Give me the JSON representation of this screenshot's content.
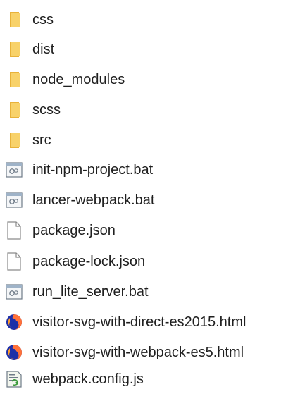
{
  "colors": {
    "folder": "#f5c542",
    "folder_dark": "#d9a520",
    "text": "#1f1f1f",
    "firefox_orange": "#ff7139",
    "firefox_blue": "#1d2fa8"
  },
  "items": [
    {
      "name": "css",
      "icon": "folder-icon"
    },
    {
      "name": "dist",
      "icon": "folder-icon"
    },
    {
      "name": "node_modules",
      "icon": "folder-icon"
    },
    {
      "name": "scss",
      "icon": "folder-icon"
    },
    {
      "name": "src",
      "icon": "folder-icon"
    },
    {
      "name": "init-npm-project.bat",
      "icon": "batch-file-icon"
    },
    {
      "name": "lancer-webpack.bat",
      "icon": "batch-file-icon"
    },
    {
      "name": "package.json",
      "icon": "blank-file-icon"
    },
    {
      "name": "package-lock.json",
      "icon": "blank-file-icon"
    },
    {
      "name": "run_lite_server.bat",
      "icon": "batch-file-icon"
    },
    {
      "name": "visitor-svg-with-direct-es2015.html",
      "icon": "firefox-html-icon"
    },
    {
      "name": "visitor-svg-with-webpack-es5.html",
      "icon": "firefox-html-icon"
    },
    {
      "name": "webpack.config.js",
      "icon": "script-file-icon"
    }
  ]
}
